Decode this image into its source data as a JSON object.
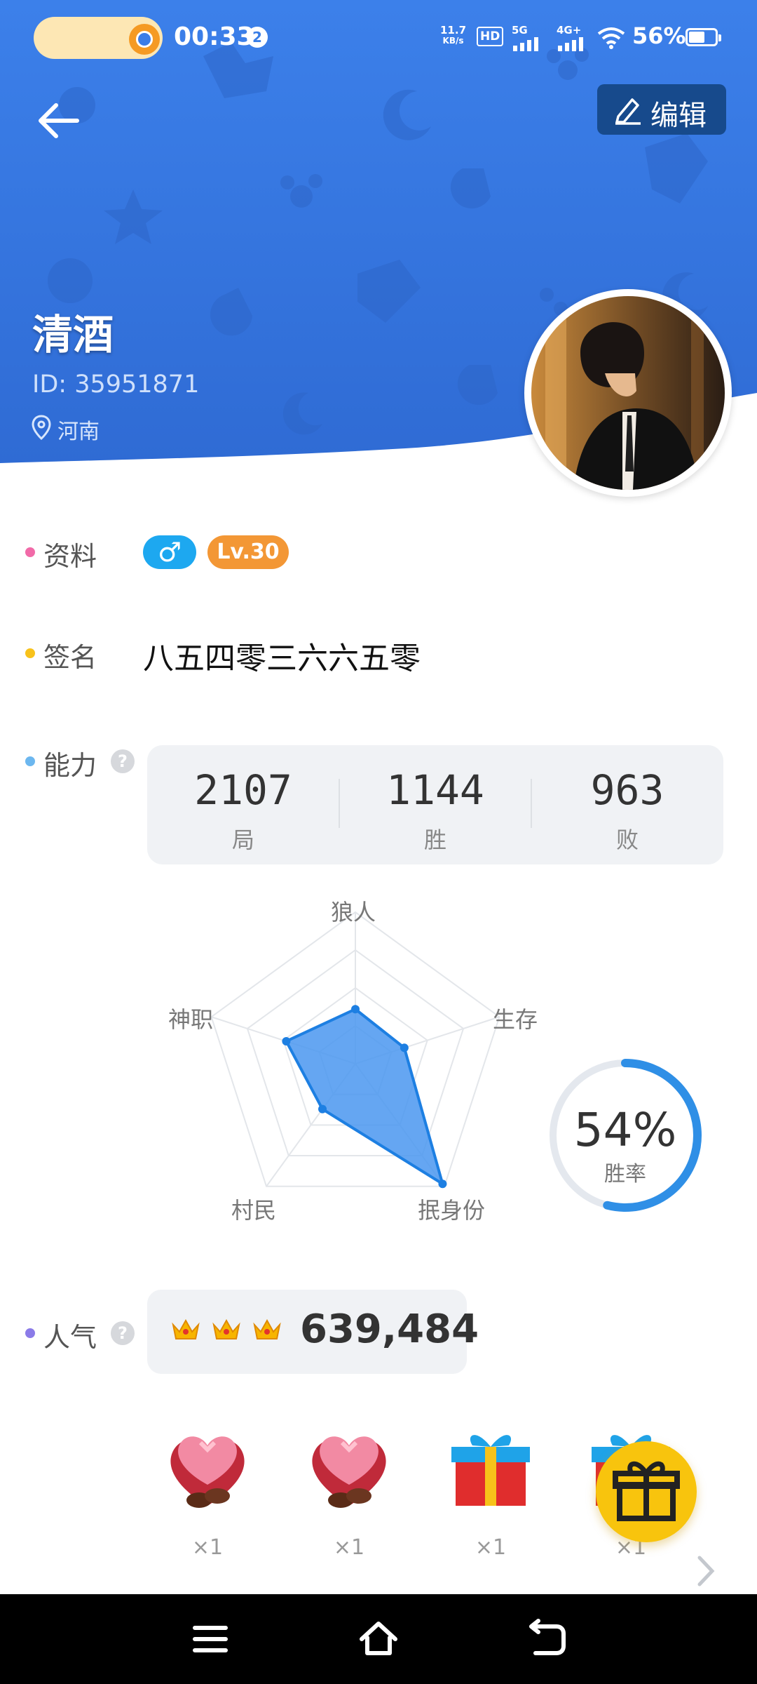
{
  "status_bar": {
    "time": "00:33",
    "notification_count": "2",
    "net_speed_value": "11.7",
    "net_speed_unit": "KB/s",
    "hd_label": "HD",
    "signal1_label": "5G",
    "signal2_label": "4G+",
    "battery": "56%"
  },
  "header": {
    "edit_label": "编辑",
    "nickname": "清酒",
    "uid": "ID: 35951871",
    "location": "河南",
    "background_color": "#3a7ee6"
  },
  "profile": {
    "info_label": "资料",
    "gender_symbol": "♂",
    "level": "Lv.30",
    "signature_label": "签名",
    "signature": "八五四零三六六五零"
  },
  "ability": {
    "label": "能力",
    "help": "?",
    "stats": [
      {
        "value": "2107",
        "label": "局"
      },
      {
        "value": "1144",
        "label": "胜"
      },
      {
        "value": "963",
        "label": "败"
      }
    ],
    "radar": {
      "axes": [
        "狼人",
        "生存",
        "抿身份",
        "村民",
        "神职"
      ],
      "values": [
        0.36,
        0.34,
        0.98,
        0.37,
        0.48
      ]
    },
    "win_rate_text": "54%",
    "win_rate_value": 0.54,
    "win_rate_label": "胜率"
  },
  "popularity": {
    "label": "人气",
    "help": "?",
    "crowns": 3,
    "value": "639,484"
  },
  "gifts": [
    {
      "icon": "heart-chocolate-box-icon",
      "count": "×1"
    },
    {
      "icon": "heart-chocolate-box-icon",
      "count": "×1"
    },
    {
      "icon": "gift-box-icon",
      "count": "×1"
    },
    {
      "icon": "gift-box-icon",
      "count": "×1"
    }
  ]
}
